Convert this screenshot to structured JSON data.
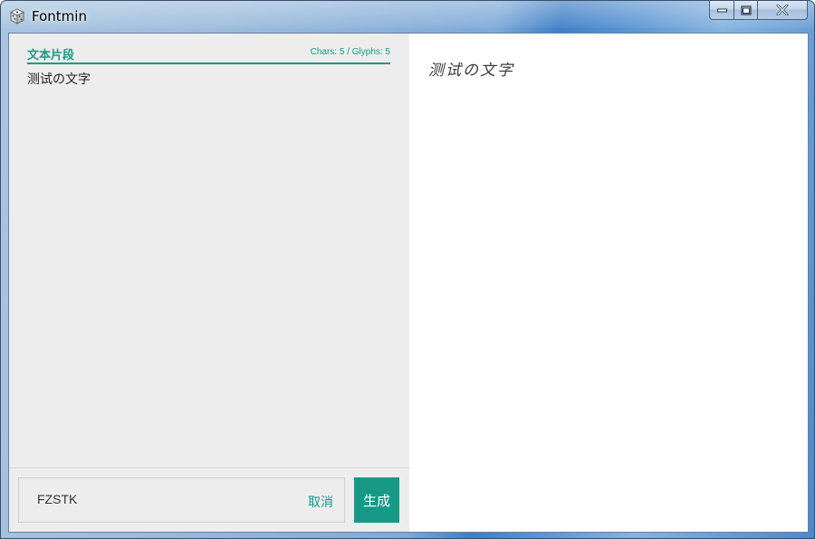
{
  "window": {
    "title": "Fontmin",
    "app_icon": "dice-icon",
    "buttons": [
      "minimize",
      "maximize",
      "close"
    ]
  },
  "editor": {
    "section_title": "文本片段",
    "counts": "Chars: 5 / Glyphs: 5",
    "text": "测试の文字"
  },
  "footer": {
    "font_name": "FZSTK",
    "cancel_label": "取消",
    "generate_label": "生成"
  },
  "preview": {
    "text": "测试の文字"
  },
  "colors": {
    "accent": "#169a87",
    "panel_bg": "#ededed",
    "preview_bg": "#ffffff"
  }
}
